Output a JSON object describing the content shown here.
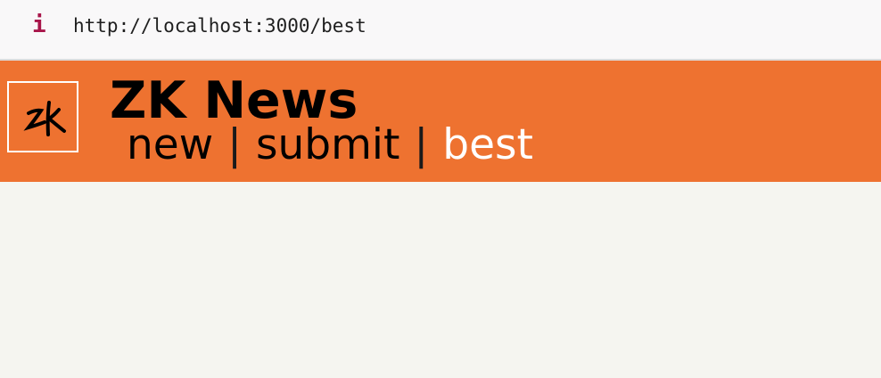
{
  "browser": {
    "info_icon": "i",
    "url": "http://localhost:3000/best"
  },
  "header": {
    "logo_icon": "zk-logo-icon",
    "title": "ZK News",
    "nav": {
      "new_label": "new",
      "separator": "|",
      "submit_label": "submit",
      "best_label": "best",
      "active": "best"
    }
  },
  "colors": {
    "header_bg": "#ee7230",
    "page_bg": "#f5f5f0",
    "active_link": "#ffffff"
  }
}
